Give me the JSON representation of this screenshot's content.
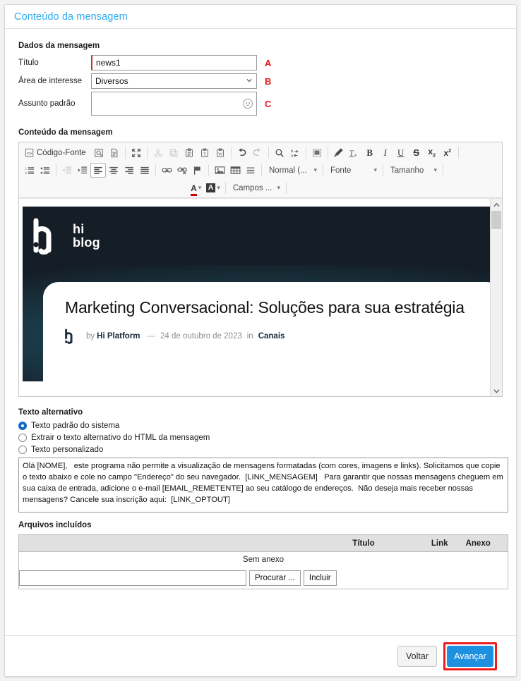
{
  "window": {
    "title": "Conteúdo da mensagem"
  },
  "message_data": {
    "section_title": "Dados da mensagem",
    "fields": [
      {
        "label": "Título",
        "value": "news1",
        "annotation": "A"
      },
      {
        "label": "Área de interesse",
        "value": "Diversos",
        "annotation": "B"
      },
      {
        "label": "Assunto padrão",
        "value": "",
        "annotation": "C"
      }
    ]
  },
  "content": {
    "section_title": "Conteúdo da mensagem",
    "toolbar": {
      "row1": [
        {
          "name": "source-code-icon",
          "label": "Código-Fonte",
          "type": "labeled"
        },
        {
          "name": "preview-icon",
          "type": "icon"
        },
        {
          "name": "templates-icon",
          "type": "icon"
        },
        {
          "sep": true
        },
        {
          "name": "maximize-icon",
          "type": "icon"
        },
        {
          "sep": true
        },
        {
          "name": "cut-icon",
          "type": "icon",
          "disabled": true
        },
        {
          "name": "copy-icon",
          "type": "icon",
          "disabled": true
        },
        {
          "name": "paste-icon",
          "type": "icon"
        },
        {
          "name": "paste-as-text-icon",
          "type": "icon"
        },
        {
          "name": "paste-from-word-icon",
          "type": "icon"
        },
        {
          "sep": true
        },
        {
          "name": "undo-icon",
          "type": "icon"
        },
        {
          "name": "redo-icon",
          "type": "icon",
          "disabled": true
        },
        {
          "sep": true
        },
        {
          "name": "find-icon",
          "type": "icon"
        },
        {
          "name": "replace-icon",
          "type": "icon"
        },
        {
          "sep": true
        },
        {
          "name": "select-all-icon",
          "type": "icon"
        },
        {
          "sep": true
        },
        {
          "name": "copy-formatting-icon",
          "type": "icon"
        },
        {
          "name": "remove-format-icon",
          "type": "icon"
        },
        {
          "name": "bold-icon",
          "type": "icon"
        },
        {
          "name": "italic-icon",
          "type": "icon"
        },
        {
          "name": "underline-icon",
          "type": "icon"
        },
        {
          "name": "strikethrough-icon",
          "type": "icon"
        },
        {
          "name": "subscript-icon",
          "type": "icon"
        },
        {
          "name": "superscript-icon",
          "type": "icon"
        },
        {
          "sep": true
        }
      ],
      "row2": [
        {
          "name": "numbered-list-icon",
          "type": "icon"
        },
        {
          "name": "bulleted-list-icon",
          "type": "icon"
        },
        {
          "sep": true
        },
        {
          "name": "decrease-indent-icon",
          "type": "icon",
          "disabled": true
        },
        {
          "name": "increase-indent-icon",
          "type": "icon"
        },
        {
          "name": "align-left-icon",
          "type": "icon",
          "active": true
        },
        {
          "name": "align-center-icon",
          "type": "icon"
        },
        {
          "name": "align-right-icon",
          "type": "icon"
        },
        {
          "name": "justify-icon",
          "type": "icon"
        },
        {
          "sep": true
        },
        {
          "name": "link-icon",
          "type": "icon"
        },
        {
          "name": "unlink-icon",
          "type": "icon"
        },
        {
          "name": "anchor-icon",
          "type": "icon"
        },
        {
          "sep": true
        },
        {
          "name": "image-icon",
          "type": "icon"
        },
        {
          "name": "table-icon",
          "type": "icon"
        },
        {
          "name": "horizontal-rule-icon",
          "type": "icon"
        },
        {
          "sep": true
        }
      ],
      "dropdowns": [
        {
          "name": "paragraph-format-dropdown",
          "label": "Normal (..."
        },
        {
          "name": "font-dropdown",
          "label": "Fonte"
        },
        {
          "name": "font-size-dropdown",
          "label": "Tamanho"
        }
      ],
      "row3": [
        {
          "name": "text-color-icon",
          "type": "split"
        },
        {
          "name": "background-color-icon",
          "type": "split"
        }
      ],
      "fields_dropdown": {
        "name": "fields-dropdown",
        "label": "Campos ..."
      }
    },
    "preview": {
      "logo_line1": "hi",
      "logo_line2": "blog",
      "article_title": "Marketing Conversacional: Soluções para sua estratégia",
      "byline_by": "by",
      "byline_author": "Hi Platform",
      "byline_dash": "—",
      "byline_date": "24 de outubro de 2023",
      "byline_in": "in",
      "byline_category": "Canais"
    }
  },
  "alt_text": {
    "section_title": "Texto alternativo",
    "options": [
      {
        "label": "Texto padrão do sistema",
        "selected": true
      },
      {
        "label": "Extrair o texto alternativo do HTML da mensagem",
        "selected": false
      },
      {
        "label": "Texto personalizado",
        "selected": false
      }
    ],
    "textarea_value": "Olá [NOME],   este programa não permite a visualização de mensagens formatadas (com cores, imagens e links). Solicitamos que copie o texto abaixo e cole no campo \"Endereço\" do seu navegador.  [LINK_MENSAGEM]   Para garantir que nossas mensagens cheguem em sua caixa de entrada, adicione o e-mail [EMAIL_REMETENTE] ao seu catálogo de endereços.  Não deseja mais receber nossas mensagens? Cancele sua inscrição aqui:  [LINK_OPTOUT]"
  },
  "attachments": {
    "section_title": "Arquivos incluídos",
    "columns": [
      "",
      "Título",
      "Link",
      "Anexo"
    ],
    "empty_message": "Sem anexo",
    "browse_label": "Procurar ...",
    "include_label": "Incluir",
    "file_input_value": ""
  },
  "footer": {
    "back_label": "Voltar",
    "next_label": "Avançar"
  },
  "colors": {
    "title_blue": "#2eacf0",
    "primary_button": "#1e90e0",
    "highlight_red": "#ee1c1c",
    "annotation_red": "#e01b1b",
    "blog_header_bg": "#151e26"
  }
}
